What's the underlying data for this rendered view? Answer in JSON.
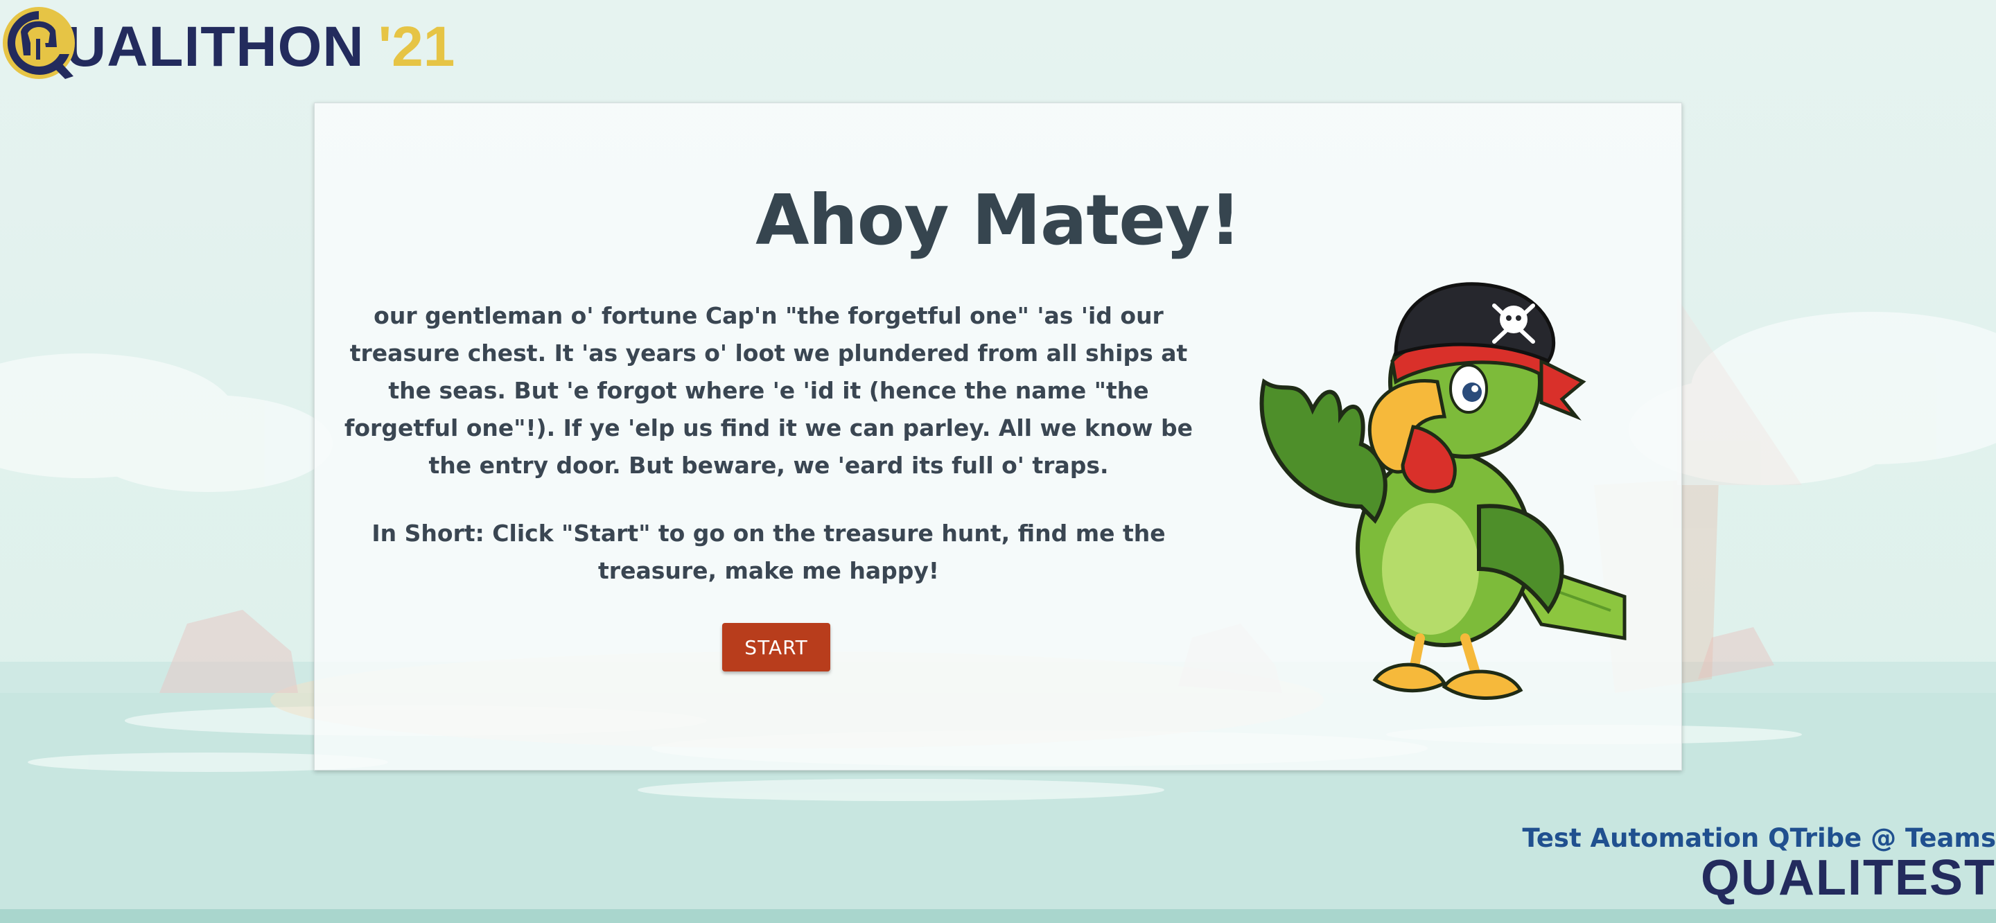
{
  "header": {
    "logo_letter_icon": "helmet-q-icon",
    "logo_word": "UALITHON",
    "logo_year": "'21"
  },
  "card": {
    "title": "Ahoy Matey!",
    "paragraph1": "our gentleman o' fortune Cap'n \"the forgetful one\" 'as 'id our treasure chest. It 'as years o' loot we plundered from all ships at the seas. But 'e forgot where 'e 'id it (hence the name \"the forgetful one\"!). If ye 'elp us find it we can parley. All we know be the entry door. But beware, we 'eard its full o' traps.",
    "paragraph2": "In Short: Click \"Start\" to go on the treasure hunt, find me the treasure, make me happy!",
    "start_label": "START",
    "illustration_icon": "pirate-parrot-illustration"
  },
  "footer": {
    "tagline": "Test Automation QTribe @ Teams",
    "brand": "QUALITEST"
  },
  "colors": {
    "brand_navy": "#232b5d",
    "brand_gold": "#e6c445",
    "button": "#b83d1c",
    "title_text": "#36454f",
    "tagline": "#20508f"
  }
}
